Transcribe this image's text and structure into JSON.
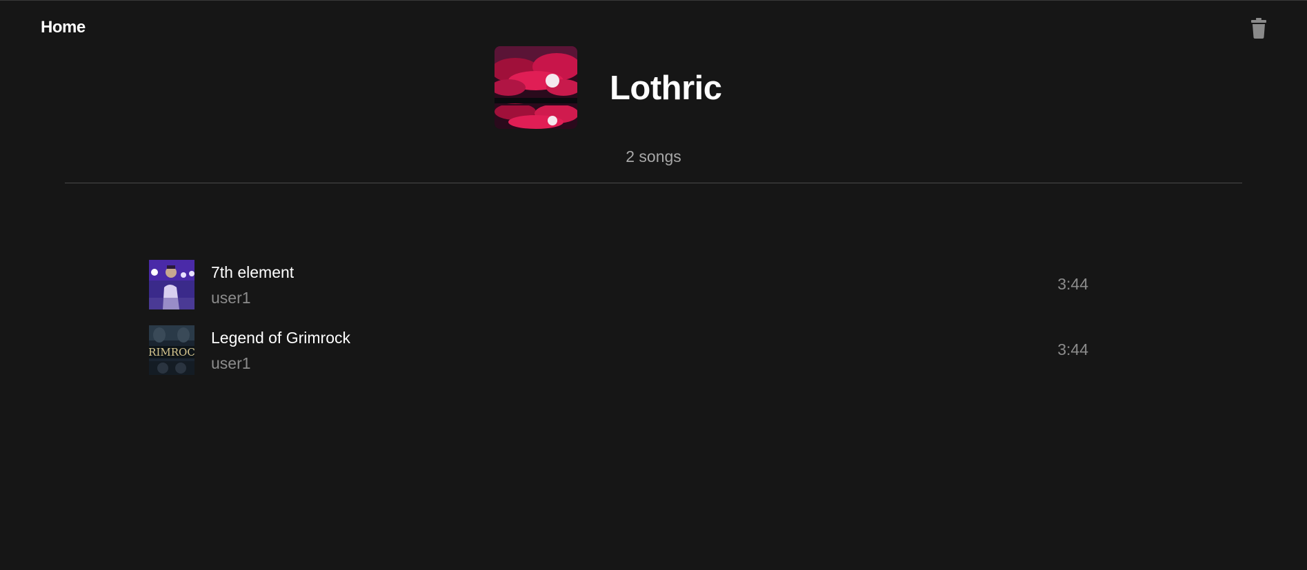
{
  "nav": {
    "home_label": "Home",
    "delete_icon": "trash-icon"
  },
  "playlist": {
    "title": "Lothric",
    "song_count": "2 songs",
    "cover_image": "red-clouds-moon-pixel-art"
  },
  "songs": [
    {
      "title": "7th element",
      "artist": "user1",
      "duration": "3:44",
      "thumbnail": "performer-on-stage-purple-lights"
    },
    {
      "title": "Legend of Grimrock",
      "artist": "user1",
      "duration": "3:44",
      "thumbnail": "grimrock-game-cover"
    }
  ],
  "colors": {
    "background": "#161616",
    "text_primary": "#ffffff",
    "text_secondary": "#8c8c8c",
    "divider": "#4a4a4a"
  }
}
